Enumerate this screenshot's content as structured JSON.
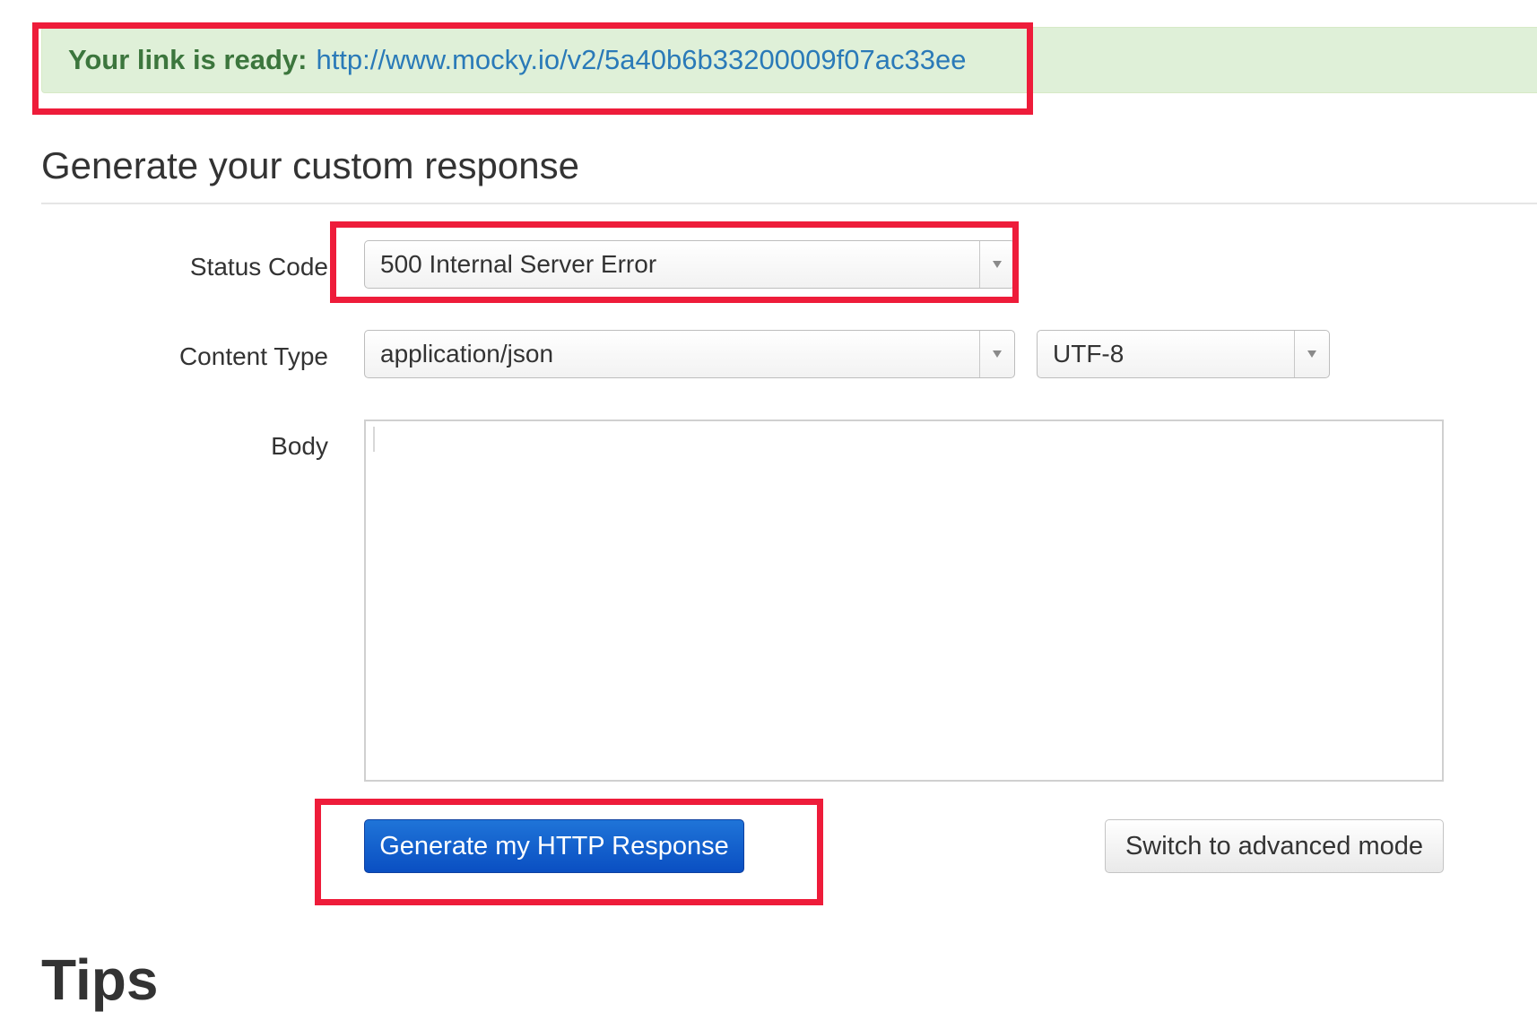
{
  "alert": {
    "label": "Your link is ready:",
    "link": "http://www.mocky.io/v2/5a40b6b33200009f07ac33ee"
  },
  "page": {
    "title": "Generate your custom response",
    "next_heading": "Tips"
  },
  "form": {
    "status_code": {
      "label": "Status Code",
      "value": "500 Internal Server Error"
    },
    "content_type": {
      "label": "Content Type",
      "value": "application/json"
    },
    "charset": {
      "value": "UTF-8"
    },
    "body": {
      "label": "Body",
      "value": ""
    }
  },
  "buttons": {
    "generate": "Generate my HTTP Response",
    "advanced": "Switch to advanced mode"
  },
  "colors": {
    "alert_background": "#dff0d8",
    "alert_text": "#3c763d",
    "link": "#2a7ab8",
    "highlight_box": "#ee1c3a",
    "primary_button": "#1565cf"
  },
  "icons": {
    "select_arrow": "caret-down-icon"
  }
}
